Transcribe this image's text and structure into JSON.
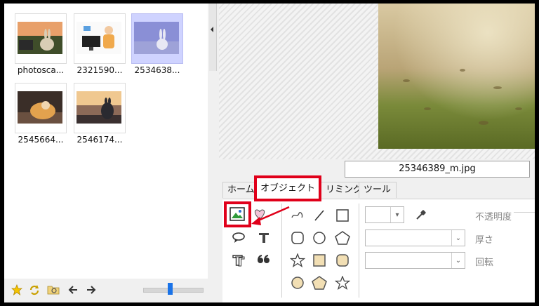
{
  "browser": {
    "thumbnails": [
      {
        "caption": "photosca..."
      },
      {
        "caption": "2321590..."
      },
      {
        "caption": "2534638..."
      },
      {
        "caption": "2545664..."
      },
      {
        "caption": "2546174..."
      }
    ]
  },
  "toolbar_icons": [
    "star-icon",
    "rotate-icon",
    "folder-search-icon",
    "back-arrow-icon",
    "forward-arrow-icon"
  ],
  "thumbnail_size_slider": {
    "value_fraction": 0.45
  },
  "preview": {
    "filename": "25346389_m.jpg"
  },
  "ribbon": {
    "tabs": [
      {
        "label": "ホーム"
      },
      {
        "label": "オブジェクト"
      },
      {
        "label": "リミング"
      },
      {
        "label": "ツール"
      }
    ],
    "active_tab": "オブジェクト",
    "props": {
      "opacity_label": "不透明度",
      "thickness_label": "厚さ",
      "rotation_label": "回転"
    }
  },
  "colors": {
    "highlight": "#e0001a",
    "selected_thumb": "#cfd3ff",
    "slider": "#1a73e8"
  }
}
